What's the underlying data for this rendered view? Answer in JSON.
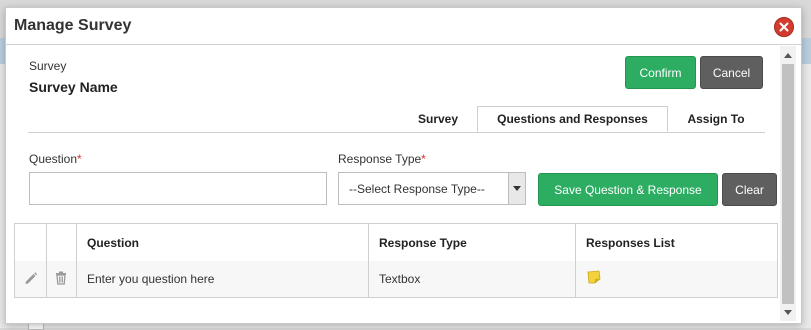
{
  "modal": {
    "title": "Manage Survey",
    "close_icon": "close-icon"
  },
  "survey": {
    "label": "Survey",
    "name": "Survey Name"
  },
  "actions": {
    "confirm_label": "Confirm",
    "cancel_label": "Cancel"
  },
  "tabs": [
    {
      "label": "Survey",
      "active": false
    },
    {
      "label": "Questions and Responses",
      "active": true
    },
    {
      "label": "Assign To",
      "active": false
    }
  ],
  "form": {
    "question_label": "Question",
    "question_value": "",
    "response_type_label": "Response Type",
    "response_type_selected": "--Select Response Type--",
    "required_marker": "*",
    "save_label": "Save Question & Response",
    "clear_label": "Clear"
  },
  "table": {
    "columns": [
      "",
      "",
      "Question",
      "Response Type",
      "Responses List"
    ],
    "rows": [
      {
        "edit_icon": "pencil-icon",
        "delete_icon": "trash-icon",
        "question": "Enter you question here",
        "response_type": "Textbox",
        "responses_icon": "sticky-note-icon"
      }
    ]
  },
  "colors": {
    "primary_green": "#2cad62",
    "secondary_gray": "#5f5f5f",
    "close_red": "#d43b2f",
    "required_red": "#d9302b"
  }
}
